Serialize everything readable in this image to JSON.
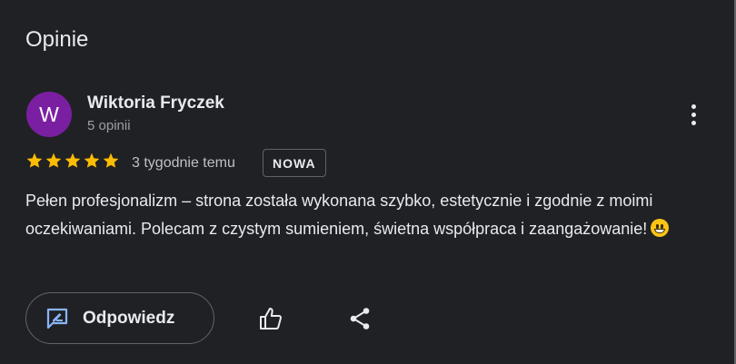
{
  "section": {
    "title": "Opinie"
  },
  "review": {
    "author_initial": "W",
    "author_name": "Wiktoria Fryczek",
    "author_meta": "5 opinii",
    "rating": 5,
    "time": "3 tygodnie temu",
    "badge": "NOWA",
    "text": "Pełen profesjonalizm – strona została wykonana szybko, estetycznie i zgodnie z moimi oczekiwaniami. Polecam z czystym sumieniem, świetna współpraca i zaangażowanie!"
  },
  "actions": {
    "reply_label": "Odpowiedz"
  },
  "colors": {
    "avatar": "#7b1fa2",
    "star": "#fbbc04",
    "background": "#202124",
    "accent_icon": "#8ab4f8"
  },
  "icons": {
    "more": "more-vert-icon",
    "reply": "reply-edit-icon",
    "like": "thumb-up-icon",
    "share": "share-icon"
  }
}
